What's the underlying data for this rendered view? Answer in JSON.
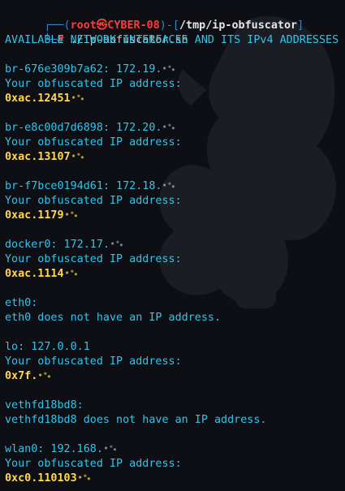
{
  "prompt": {
    "user": "root",
    "skull_glyph": "㉿",
    "host": "CYBER-08",
    "path": "/tmp/ip-obfuscator",
    "hash": "#",
    "command": "./ip-obfuscator.sh"
  },
  "header": "AVAILABLE NETWORK INTERFACES AND ITS IPv4 ADDRESSES",
  "obfuscated_label": "Your obfuscated IP address:",
  "interfaces": [
    {
      "addr_line": "br-676e309b7a62: 172.19.",
      "obfuscated": "0xac.12451"
    },
    {
      "addr_line": "br-e8c00d7d6898: 172.20.",
      "obfuscated": "0xac.13107"
    },
    {
      "addr_line": "br-f7bce0194d61: 172.18.",
      "obfuscated": "0xac.1179"
    },
    {
      "addr_line": "docker0: 172.17.",
      "obfuscated": "0xac.1114"
    },
    {
      "addr_line": "eth0:",
      "message": "eth0 does not have an IP address."
    },
    {
      "addr_line": "lo: 127.0.0.1",
      "obfuscated": "0x7f."
    },
    {
      "addr_line": "vethfd18bd8:",
      "message": "vethfd18bd8 does not have an IP address."
    },
    {
      "addr_line": "wlan0: 192.168.",
      "obfuscated": "0xc0.110103"
    }
  ],
  "colors": {
    "background": "#0d0f14",
    "prompt_frame": "#3b82c6",
    "prompt_user": "#ff3b3b",
    "text": "#e6e6e6",
    "output": "#36c3e6",
    "obfuscated": "#ffd84d"
  }
}
